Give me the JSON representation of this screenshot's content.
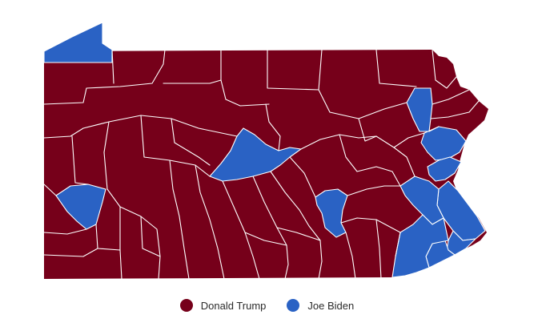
{
  "colors": {
    "trump": "#76001a",
    "biden": "#2a62c4"
  },
  "legend": [
    {
      "label": "Donald Trump",
      "color_key": "trump"
    },
    {
      "label": "Joe Biden",
      "color_key": "biden"
    }
  ],
  "winners": {
    "Erie": "biden",
    "Allegheny": "biden",
    "Centre": "biden",
    "Lackawanna": "biden",
    "Northampton": "biden",
    "Lehigh": "biden",
    "Bucks": "biden",
    "Montgomery": "biden",
    "Philadelphia": "biden",
    "Delaware": "biden",
    "Chester": "biden",
    "Dauphin": "biden",
    "rest_of_state": "trump"
  }
}
